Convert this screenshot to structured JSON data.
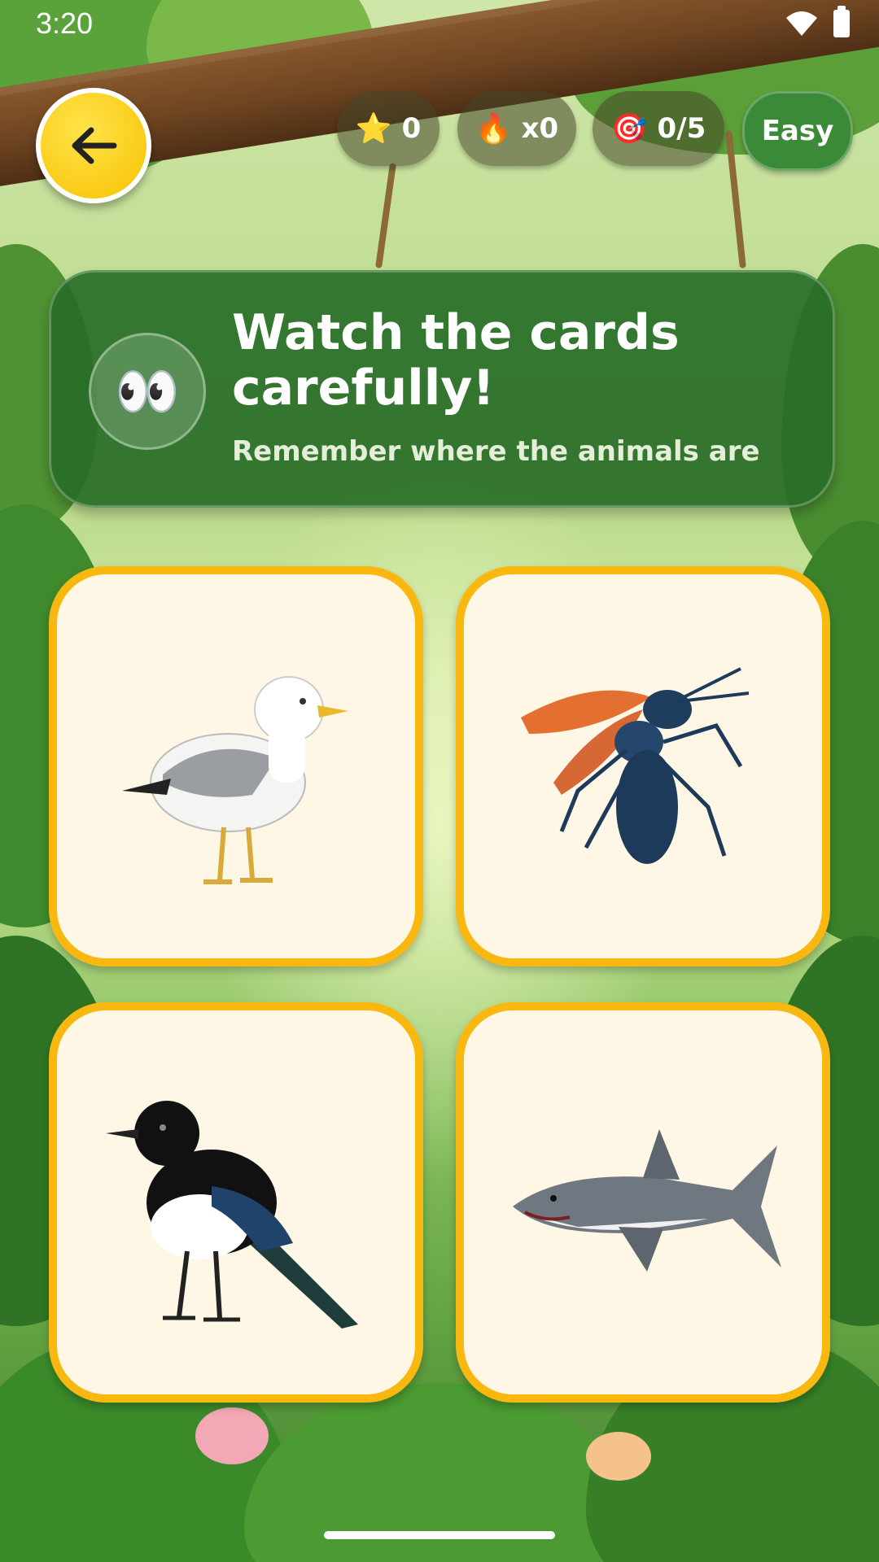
{
  "status_bar": {
    "time": "3:20"
  },
  "top_bar": {
    "back_icon": "arrow-left-icon",
    "stars": {
      "icon": "⭐",
      "value": "0"
    },
    "streak": {
      "icon": "🔥",
      "value": "x0"
    },
    "progress": {
      "icon": "🎯",
      "value": "0/5"
    },
    "difficulty": "Easy"
  },
  "banner": {
    "icon": "👀",
    "title": "Watch the cards carefully!",
    "subtitle": "Remember where the animals are"
  },
  "cards": [
    {
      "animal": "seagull"
    },
    {
      "animal": "wasp"
    },
    {
      "animal": "magpie"
    },
    {
      "animal": "shark"
    }
  ],
  "colors": {
    "accent": "#f9b80f",
    "banner": "#2f7a30",
    "difficulty": "#3b8a38"
  }
}
